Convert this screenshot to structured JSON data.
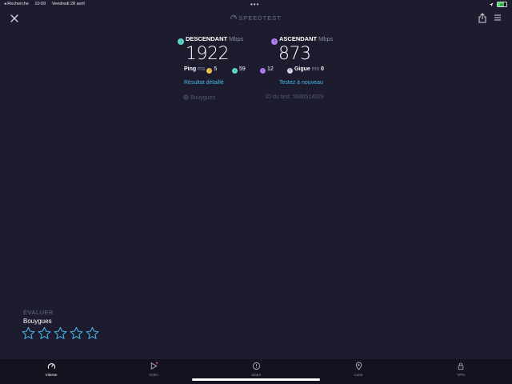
{
  "statusbar": {
    "back_label": "◂ Recherche",
    "time": "10:09",
    "date": "Vendredi 28 avril",
    "dots": "•••",
    "battery": "60"
  },
  "header": {
    "brand": "SPEEDTEST"
  },
  "results": {
    "download": {
      "label": "DESCENDANT",
      "unit": "Mbps",
      "value": "1922",
      "color": "#5fd7c5"
    },
    "upload": {
      "label": "ASCENDANT",
      "unit": "Mbps",
      "value": "873",
      "color": "#b07cf0"
    },
    "ping": {
      "label": "Ping",
      "unit": "ms",
      "idle": "5",
      "download": "59",
      "upload": "12"
    },
    "jitter": {
      "label": "Gigue",
      "unit": "ms",
      "value": "0"
    },
    "detailed_link": "Résultat détaillé",
    "retest_link": "Testez à nouveau",
    "provider": "Bouygues",
    "test_id": "ID du test: 5586514929"
  },
  "rating": {
    "label": "ÉVALUER",
    "provider": "Bouygues",
    "stars": 5,
    "star_color": "#49b6ec"
  },
  "tabs": [
    {
      "label": "Vitesse",
      "icon": "speed-icon"
    },
    {
      "label": "Vidéo",
      "icon": "video-icon"
    },
    {
      "label": "Statut",
      "icon": "status-icon"
    },
    {
      "label": "Carte",
      "icon": "map-pin-icon"
    },
    {
      "label": "VPN",
      "icon": "vpn-icon"
    }
  ]
}
